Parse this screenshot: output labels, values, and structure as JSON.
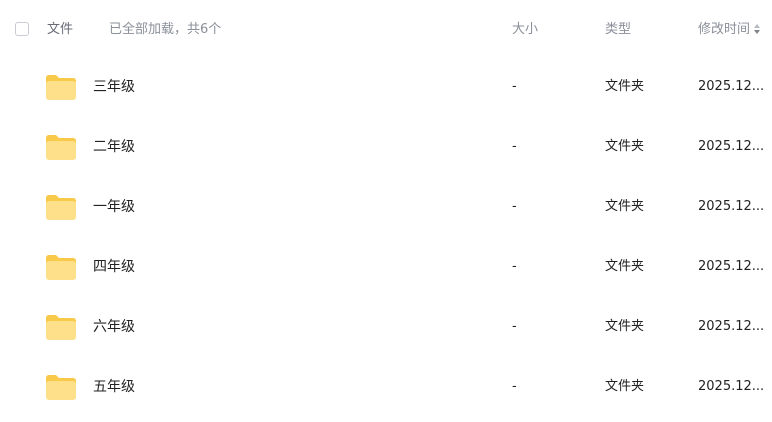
{
  "header": {
    "name_label": "文件",
    "status_text": "已全部加载，共6个",
    "size_label": "大小",
    "type_label": "类型",
    "mtime_label": "修改时间"
  },
  "colors": {
    "folder_body": "#FFE08A",
    "folder_tab": "#F9C94A",
    "header_text": "#8A8F99",
    "text": "#222222"
  },
  "rows": [
    {
      "name": "三年级",
      "size": "-",
      "type": "文件夹",
      "mtime": "2025.12...",
      "icon": "folder-icon"
    },
    {
      "name": "二年级",
      "size": "-",
      "type": "文件夹",
      "mtime": "2025.12...",
      "icon": "folder-icon"
    },
    {
      "name": "一年级",
      "size": "-",
      "type": "文件夹",
      "mtime": "2025.12...",
      "icon": "folder-icon"
    },
    {
      "name": "四年级",
      "size": "-",
      "type": "文件夹",
      "mtime": "2025.12...",
      "icon": "folder-icon"
    },
    {
      "name": "六年级",
      "size": "-",
      "type": "文件夹",
      "mtime": "2025.12...",
      "icon": "folder-icon"
    },
    {
      "name": "五年级",
      "size": "-",
      "type": "文件夹",
      "mtime": "2025.12...",
      "icon": "folder-icon"
    }
  ]
}
